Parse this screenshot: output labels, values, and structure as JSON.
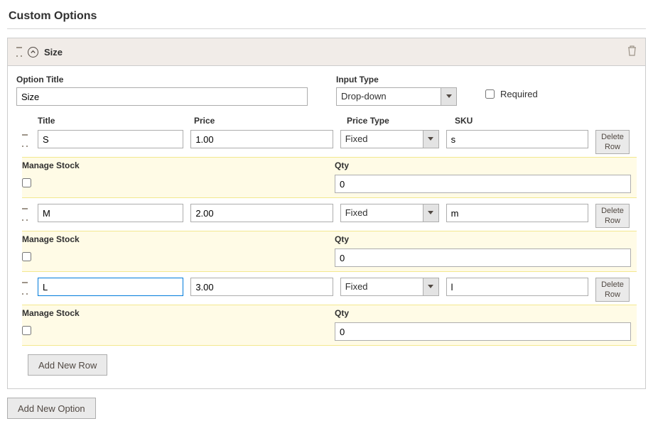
{
  "section": {
    "title": "Custom Options"
  },
  "option": {
    "name": "Size",
    "title_label": "Option Title",
    "title_value": "Size",
    "type_label": "Input Type",
    "type_value": "Drop-down",
    "required_label": "Required",
    "required_checked": false
  },
  "value_headers": {
    "title": "Title",
    "price": "Price",
    "price_type": "Price Type",
    "sku": "SKU"
  },
  "highlight_headers": {
    "manage_stock": "Manage Stock",
    "qty": "Qty"
  },
  "values": [
    {
      "title": "S",
      "price": "1.00",
      "price_type": "Fixed",
      "sku": "s",
      "manage_stock": false,
      "qty": "0",
      "active": false
    },
    {
      "title": "M",
      "price": "2.00",
      "price_type": "Fixed",
      "sku": "m",
      "manage_stock": false,
      "qty": "0",
      "active": false
    },
    {
      "title": "L",
      "price": "3.00",
      "price_type": "Fixed",
      "sku": "l",
      "manage_stock": false,
      "qty": "0",
      "active": true
    }
  ],
  "buttons": {
    "delete_row": "Delete Row",
    "add_new_row": "Add New Row",
    "add_new_option": "Add New Option"
  }
}
